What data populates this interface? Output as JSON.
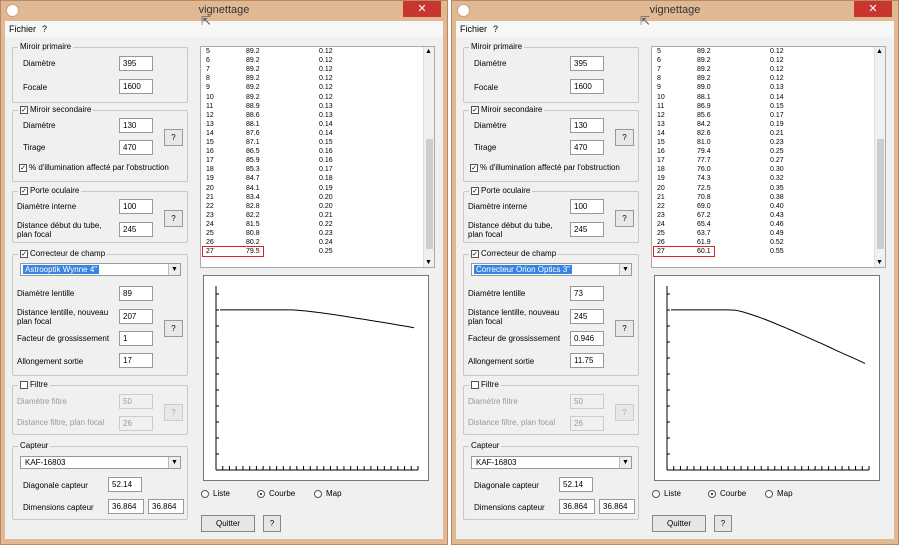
{
  "windows": [
    {
      "title": "vignettage",
      "close_label": "✕",
      "menu": {
        "fichier": "Fichier",
        "help": "?"
      },
      "miroir_primaire": {
        "title": "Miroir primaire",
        "diametre_label": "Diamètre",
        "diametre": "395",
        "focale_label": "Focale",
        "focale": "1600"
      },
      "miroir_secondaire": {
        "checked": true,
        "title": "Miroir secondaire",
        "diametre_label": "Diamètre",
        "diametre": "130",
        "tirage_label": "Tirage",
        "tirage": "470",
        "q_label": "?",
        "illum_checked": true,
        "illum_label": "% d'illumination affecté par l'obstruction"
      },
      "porte_oculaire": {
        "checked": true,
        "title": "Porte oculaire",
        "diam_label": "Diamètre interne",
        "diam": "100",
        "dist_label1": "Distance début du tube,",
        "dist_label2": "plan focal",
        "dist": "245",
        "q_label": "?"
      },
      "correcteur": {
        "checked": true,
        "title": "Correcteur de champ",
        "selected": "Astrooptik Wynne 4\"",
        "lentille_label": "Diamètre lentille",
        "lentille": "89",
        "dist_label1": "Distance lentille, nouveau",
        "dist_label2": "plan focal",
        "dist": "207",
        "facteur_label": "Facteur de grossissement",
        "facteur": "1",
        "allong_label": "Allongement sortie",
        "allong": "17",
        "q_label": "?"
      },
      "filtre": {
        "checked": false,
        "title": "Filtre",
        "diam_label": "Diamètre filtre",
        "diam": "50",
        "dist_label": "Distance filtre, plan focal",
        "dist": "26",
        "q_label": "?"
      },
      "capteur": {
        "title": "Capteur",
        "selected": "KAF-16803",
        "diag_label": "Diagonale capteur",
        "diag": "52.14",
        "dim_label": "Dimensions capteur",
        "dim_w": "36.864",
        "dim_h": "36.864"
      },
      "list_rows": [
        [
          "5",
          "89.2",
          "0.12"
        ],
        [
          "6",
          "89.2",
          "0.12"
        ],
        [
          "7",
          "89.2",
          "0.12"
        ],
        [
          "8",
          "89.2",
          "0.12"
        ],
        [
          "9",
          "89.2",
          "0.12"
        ],
        [
          "10",
          "89.2",
          "0.12"
        ],
        [
          "11",
          "88.9",
          "0.13"
        ],
        [
          "12",
          "88.6",
          "0.13"
        ],
        [
          "13",
          "88.1",
          "0.14"
        ],
        [
          "14",
          "87.6",
          "0.14"
        ],
        [
          "15",
          "87.1",
          "0.15"
        ],
        [
          "16",
          "86.5",
          "0.16"
        ],
        [
          "17",
          "85.9",
          "0.16"
        ],
        [
          "18",
          "85.3",
          "0.17"
        ],
        [
          "19",
          "84.7",
          "0.18"
        ],
        [
          "20",
          "84.1",
          "0.19"
        ],
        [
          "21",
          "83.4",
          "0.20"
        ],
        [
          "22",
          "82.8",
          "0.20"
        ],
        [
          "23",
          "82.2",
          "0.21"
        ],
        [
          "24",
          "81.5",
          "0.22"
        ],
        [
          "25",
          "80.8",
          "0.23"
        ],
        [
          "26",
          "80.2",
          "0.24"
        ],
        [
          "27",
          "79.5",
          "0.25"
        ]
      ],
      "radio": {
        "liste": "Liste",
        "courbe": "Courbe",
        "map": "Map",
        "selected": "courbe"
      },
      "quitter": "Quitter",
      "help_btn": "?"
    },
    {
      "title": "vignettage",
      "close_label": "✕",
      "menu": {
        "fichier": "Fichier",
        "help": "?"
      },
      "miroir_primaire": {
        "title": "Miroir primaire",
        "diametre_label": "Diamètre",
        "diametre": "395",
        "focale_label": "Focale",
        "focale": "1600"
      },
      "miroir_secondaire": {
        "checked": true,
        "title": "Miroir secondaire",
        "diametre_label": "Diamètre",
        "diametre": "130",
        "tirage_label": "Tirage",
        "tirage": "470",
        "q_label": "?",
        "illum_checked": true,
        "illum_label": "% d'illumination affecté par l'obstruction"
      },
      "porte_oculaire": {
        "checked": true,
        "title": "Porte oculaire",
        "diam_label": "Diamètre interne",
        "diam": "100",
        "dist_label1": "Distance début du tube,",
        "dist_label2": "plan focal",
        "dist": "245",
        "q_label": "?"
      },
      "correcteur": {
        "checked": true,
        "title": "Correcteur de champ",
        "selected": "Correcteur Orion Optics 3\"",
        "lentille_label": "Diamètre lentille",
        "lentille": "73",
        "dist_label1": "Distance lentille, nouveau",
        "dist_label2": "plan focal",
        "dist": "245",
        "facteur_label": "Facteur de grossissement",
        "facteur": "0.946",
        "allong_label": "Allongement sortie",
        "allong": "11.75",
        "q_label": "?"
      },
      "filtre": {
        "checked": false,
        "title": "Filtre",
        "diam_label": "Diamètre filtre",
        "diam": "50",
        "dist_label": "Distance filtre, plan focal",
        "dist": "26",
        "q_label": "?"
      },
      "capteur": {
        "title": "Capteur",
        "selected": "KAF-16803",
        "diag_label": "Diagonale capteur",
        "diag": "52.14",
        "dim_label": "Dimensions capteur",
        "dim_w": "36.864",
        "dim_h": "36.864"
      },
      "list_rows": [
        [
          "5",
          "89.2",
          "0.12"
        ],
        [
          "6",
          "89.2",
          "0.12"
        ],
        [
          "7",
          "89.2",
          "0.12"
        ],
        [
          "8",
          "89.2",
          "0.12"
        ],
        [
          "9",
          "89.0",
          "0.13"
        ],
        [
          "10",
          "88.1",
          "0.14"
        ],
        [
          "11",
          "86.9",
          "0.15"
        ],
        [
          "12",
          "85.6",
          "0.17"
        ],
        [
          "13",
          "84.2",
          "0.19"
        ],
        [
          "14",
          "82.6",
          "0.21"
        ],
        [
          "15",
          "81.0",
          "0.23"
        ],
        [
          "16",
          "79.4",
          "0.25"
        ],
        [
          "17",
          "77.7",
          "0.27"
        ],
        [
          "18",
          "76.0",
          "0.30"
        ],
        [
          "19",
          "74.3",
          "0.32"
        ],
        [
          "20",
          "72.5",
          "0.35"
        ],
        [
          "21",
          "70.8",
          "0.38"
        ],
        [
          "22",
          "69.0",
          "0.40"
        ],
        [
          "23",
          "67.2",
          "0.43"
        ],
        [
          "24",
          "65.4",
          "0.46"
        ],
        [
          "25",
          "63.7",
          "0.49"
        ],
        [
          "26",
          "61.9",
          "0.52"
        ],
        [
          "27",
          "60.1",
          "0.55"
        ]
      ],
      "radio": {
        "liste": "Liste",
        "courbe": "Courbe",
        "map": "Map",
        "selected": "courbe"
      },
      "quitter": "Quitter",
      "help_btn": "?"
    }
  ]
}
